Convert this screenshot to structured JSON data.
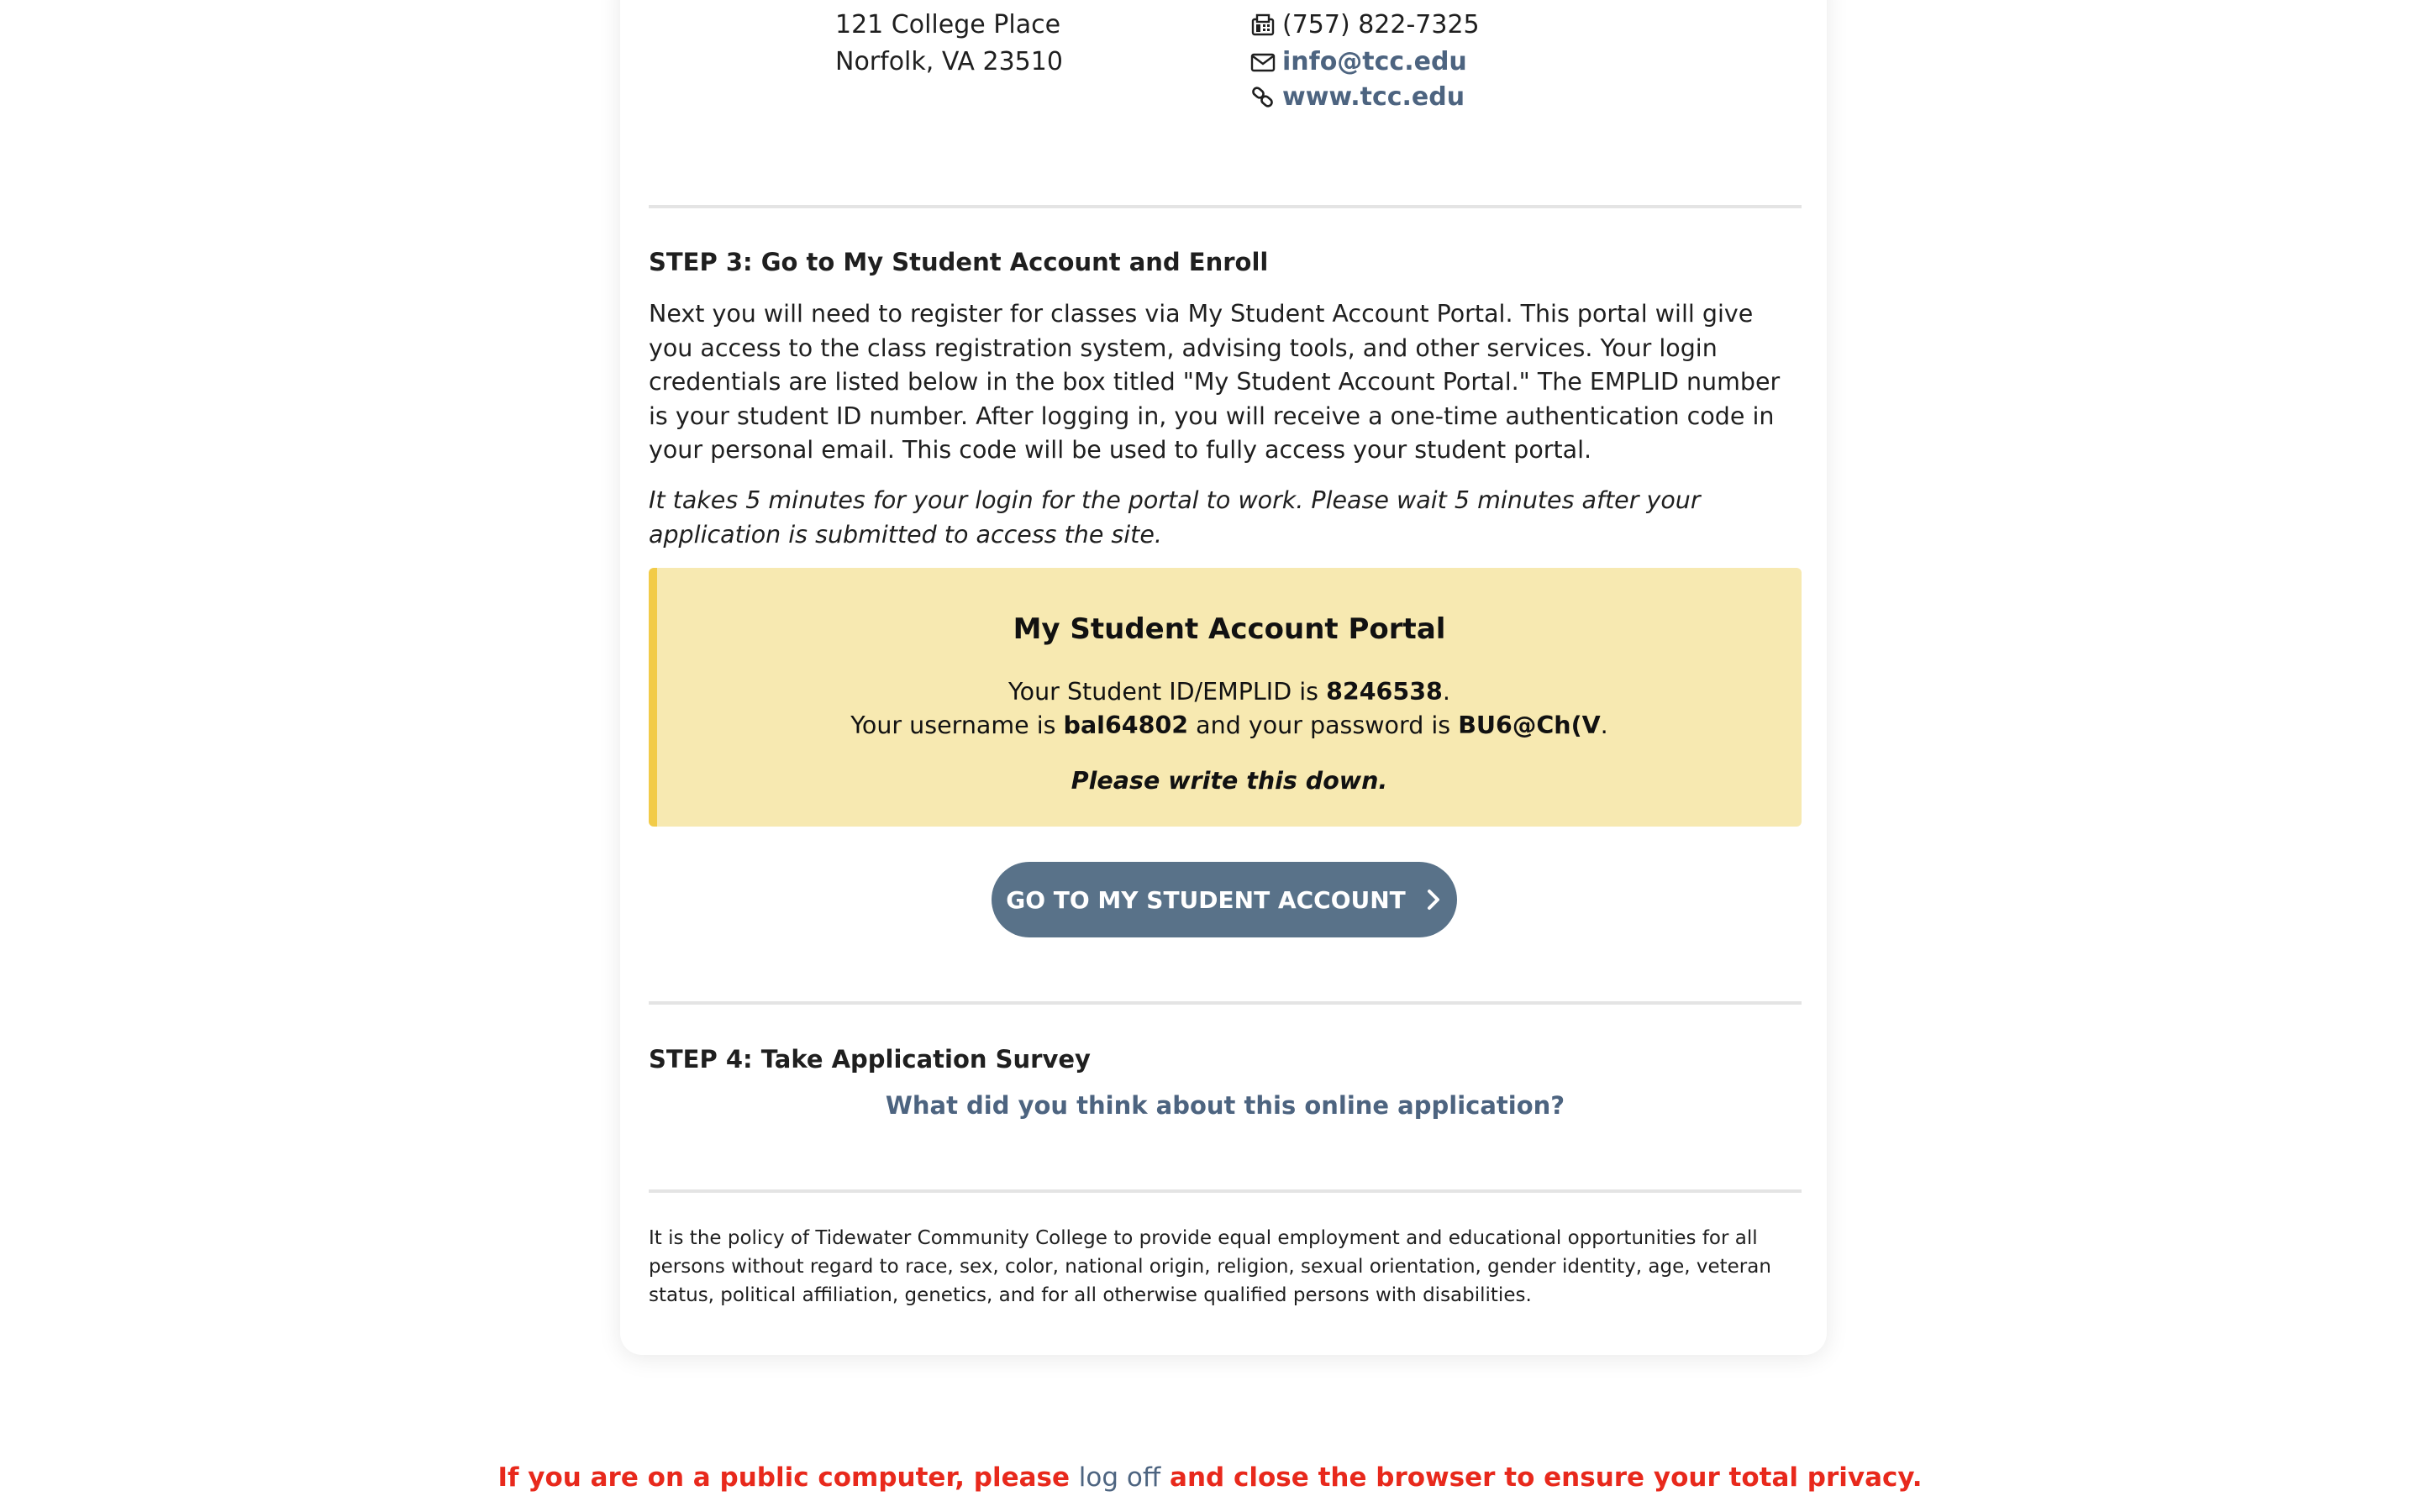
{
  "address": {
    "line1": "121 College Place",
    "line2": "Norfolk, VA  23510"
  },
  "contact": {
    "fax": "(757) 822-7325",
    "email": "info@tcc.edu",
    "website": "www.tcc.edu",
    "fax_icon": "fax-icon",
    "email_icon": "envelope-icon",
    "website_icon": "link-icon"
  },
  "step3": {
    "title": "STEP 3: Go to My Student Account and Enroll",
    "body": "Next you will need to register for classes via My Student Account Portal. This portal will give you access to the class registration system, advising tools, and other services. Your login credentials are listed below in the box titled \"My Student Account Portal.\" The EMPLID number is your student ID number. After logging in, you will receive a one-time authentication code in your personal email. This code will be used to fully access your student portal.",
    "note": "It takes 5 minutes for your login for the portal to work. Please wait 5 minutes after your application is submitted to access the site."
  },
  "portal": {
    "title": "My Student Account Portal",
    "id_prefix": "Your Student ID/EMPLID is ",
    "emplid": "8246538",
    "id_suffix": ".",
    "user_prefix": "Your username is ",
    "username": "bal64802",
    "password_mid": " and your password is ",
    "password": "BU6@Ch(V",
    "user_suffix": ".",
    "reminder": "Please write this down."
  },
  "button": {
    "label": "GO TO MY STUDENT ACCOUNT",
    "icon": "chevron-right-icon"
  },
  "step4": {
    "title": "STEP 4: Take Application Survey",
    "survey_link": "What did you think about this online application?"
  },
  "policy": "It is the policy of Tidewater Community College to provide equal employment and educational opportunities for all persons without regard to race, sex, color, national origin, religion, sexual orientation, gender identity, age, veteran status, political affiliation, genetics, and for all otherwise qualified persons with disabilities.",
  "privacy": {
    "before": "If you are on a public computer, please ",
    "link": "log off",
    "after": " and close the browser to ensure your total privacy."
  },
  "colors": {
    "link": "#4d6480",
    "button": "#597289",
    "portal_bg": "#f7e9b1",
    "portal_accent": "#f2cb48",
    "privacy": "#e8291c"
  }
}
